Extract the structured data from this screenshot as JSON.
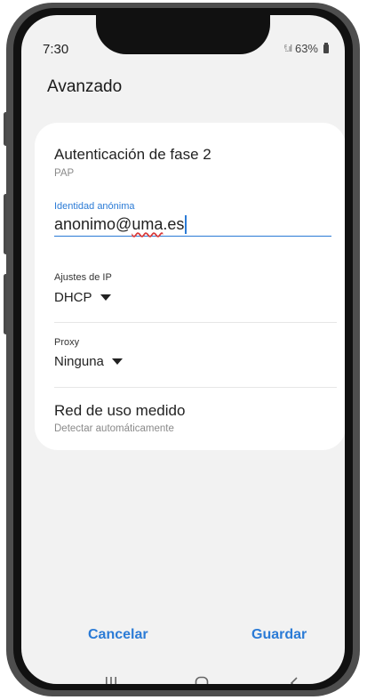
{
  "status": {
    "time": "7:30",
    "signal": "ⁱ⁞.ıl",
    "battery": "63%"
  },
  "header": {
    "title": "Avanzado"
  },
  "settings": {
    "phase2": {
      "title": "Autenticación de fase 2",
      "value": "PAP"
    },
    "anon_identity": {
      "label": "Identidad anónima",
      "value_prefix": "anonimo@",
      "value_underlined": "uma",
      "value_suffix": ".es"
    },
    "ip": {
      "label": "Ajustes de IP",
      "value": "DHCP"
    },
    "proxy": {
      "label": "Proxy",
      "value": "Ninguna"
    },
    "metered": {
      "title": "Red de uso medido",
      "value": "Detectar automáticamente"
    }
  },
  "actions": {
    "cancel": "Cancelar",
    "save": "Guardar"
  },
  "navbar": {
    "recent_icon": "recent-apps-icon",
    "home_icon": "home-icon",
    "back_icon": "back-icon"
  },
  "colors": {
    "accent": "#2b7bd6",
    "card": "#ffffff",
    "screen_bg": "#f2f2f2",
    "spellcheck": "#d83a3a"
  }
}
